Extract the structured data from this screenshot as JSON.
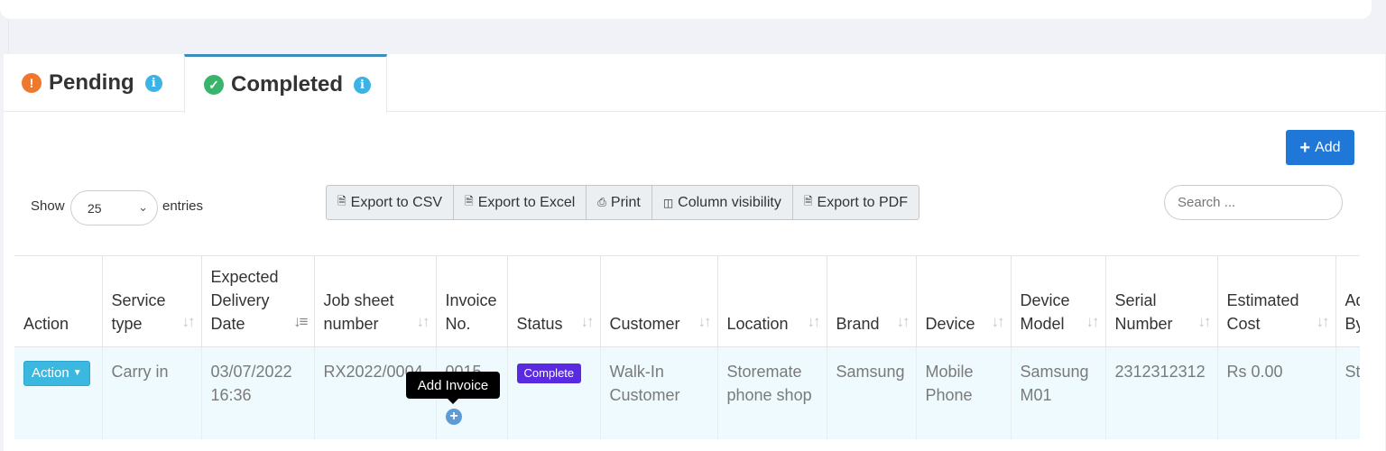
{
  "tabs": [
    {
      "label": "Pending",
      "icon": "exclamation-icon"
    },
    {
      "label": "Completed",
      "icon": "check-icon",
      "active": true
    }
  ],
  "add_label": "Add",
  "show_label": "Show",
  "entries_label": "entries",
  "page_size": "25",
  "export_buttons": [
    "Export to CSV",
    "Export to Excel",
    "Print",
    "Column visibility",
    "Export to PDF"
  ],
  "search_placeholder": "Search ...",
  "columns": [
    "Action",
    "Service type",
    "Expected Delivery Date",
    "Job sheet number",
    "Invoice No.",
    "Status",
    "Customer",
    "Location",
    "Brand",
    "Device",
    "Device Model",
    "Serial Number",
    "Estimated Cost",
    "Added By"
  ],
  "row": {
    "action": "Action",
    "service_type": "Carry in",
    "delivery_date": "03/07/2022 16:36",
    "job_sheet": "RX2022/0004",
    "invoice_no": "0015",
    "status": "Complete",
    "customer": "Walk-In Customer",
    "location": "Storemate phone shop",
    "brand": "Samsung",
    "device": "Mobile Phone",
    "device_model": "Samsung M01",
    "serial": "2312312312",
    "cost": "Rs 0.00",
    "added_by": "St"
  },
  "tooltip": "Add Invoice",
  "colors": {
    "accent": "#1f77d8",
    "status_badge": "#5a2ae0",
    "action_button": "#3bb8e0",
    "pending": "#f0782c",
    "completed": "#38b46c"
  }
}
